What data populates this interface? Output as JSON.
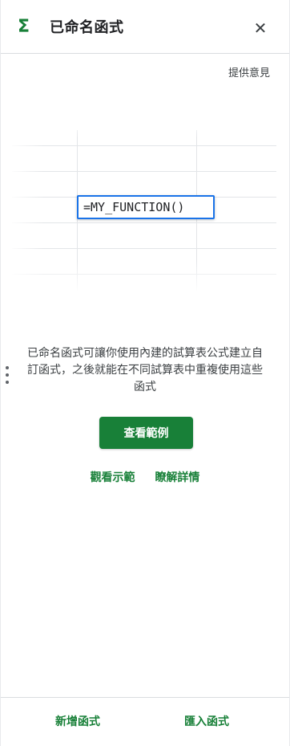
{
  "header": {
    "icon": "sigma-icon",
    "title": "已命名函式",
    "close_icon": "close-icon"
  },
  "feedback_label": "提供意見",
  "illustration": {
    "formula_text": "=MY_FUNCTION()"
  },
  "description": "已命名函式可讓你使用內建的試算表公式建立自訂函式，之後就能在不同試算表中重複使用這些函式",
  "primary_button_label": "查看範例",
  "links": {
    "watch_demo": "觀看示範",
    "learn_more": "瞭解詳情"
  },
  "footer": {
    "new_function": "新增函式",
    "import_function": "匯入函式"
  },
  "colors": {
    "accent": "#188038",
    "cell_border": "#1a73e8"
  }
}
